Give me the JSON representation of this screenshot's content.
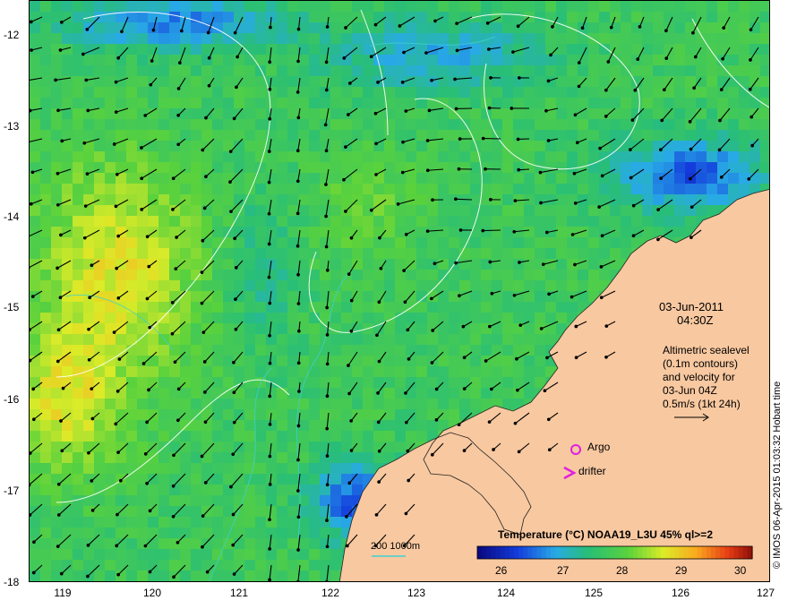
{
  "map": {
    "lon_ticks": [
      "119",
      "120",
      "121",
      "122",
      "123",
      "124",
      "125",
      "126",
      "127"
    ],
    "lat_ticks": [
      "-12",
      "-13",
      "-14",
      "-15",
      "-16",
      "-17",
      "-18"
    ],
    "date": "03-Jun-2011",
    "time": "04:30Z",
    "legend_lines": [
      "Altimetric sealevel",
      "(0.1m contours)",
      "and velocity for",
      "03-Jun 04Z",
      "0.5m/s (1kt 24h)"
    ],
    "argo_label": "Argo",
    "drifter_label": "drifter",
    "depth_label": "200  1000m",
    "colorbar_title": "Temperature (°C) NOAA19_L3U 45% ql>=2",
    "colorbar_ticks": [
      "26",
      "27",
      "28",
      "29",
      "30"
    ],
    "credit": "© IMOS 06-Apr-2015 01:03:32 Hobart time",
    "colors": {
      "land": "#f8c8a0",
      "argo": "#e020e0",
      "drifter": "#e020e0",
      "contour": "#ffffff",
      "depth_contour": "#40d0d0"
    }
  }
}
